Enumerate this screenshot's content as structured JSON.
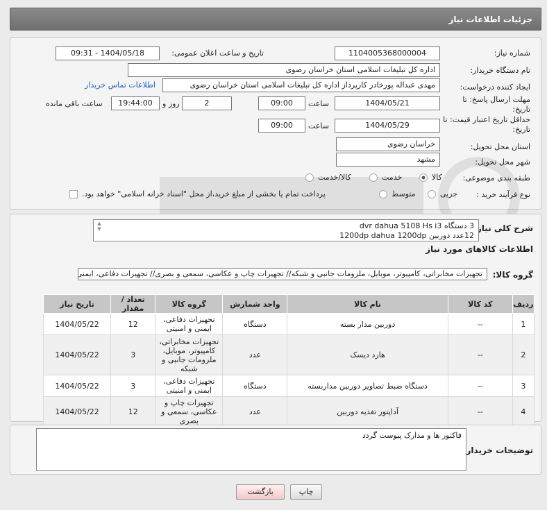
{
  "header": {
    "title": "جزئیات اطلاعات نیاز"
  },
  "form": {
    "need_number_label": "شماره نیاز:",
    "need_number": "1104005368000004",
    "announce_label": "تاریخ و ساعت اعلان عمومی:",
    "announce_value": "1404/05/18 - 09:31",
    "buyer_org_label": "نام دستگاه خریدار:",
    "buyer_org": "اداره کل تبلیغات اسلامی استان خراسان رضوی",
    "creator_label": "ایجاد کننده درخواست:",
    "creator": "مهدی عبداله پورخادر کارپرداز اداره کل تبلیغات اسلامی استان خراسان رضوی",
    "contact_link": "اطلاعات تماس خریدار",
    "deadline_label": "مهلت ارسال پاسخ: تا تاریخ:",
    "deadline_date": "1404/05/21",
    "time_label": "ساعت",
    "deadline_time": "09:00",
    "days_count": "2",
    "days_label": "روز و",
    "remaining_time": "19:44:00",
    "remaining_label": "ساعت باقی مانده",
    "price_validity_label": "حداقل تاریخ اعتبار قیمت: تا تاریخ:",
    "price_validity_date": "1404/05/29",
    "price_validity_time": "09:00",
    "province_label": "استان محل تحویل:",
    "province": "خراسان رضوی",
    "city_label": "شهر محل تحویل:",
    "city": "مشهد",
    "category_label": "طبقه بندی موضوعی:",
    "category_options": [
      "کالا",
      "خدمت",
      "کالا/خدمت"
    ],
    "process_label": "نوع فرآیند خرید :",
    "process_options": [
      "جزیی",
      "متوسط"
    ],
    "payment_note": "پرداخت تمام یا بخشی از مبلغ خرید،از محل \"اسناد خزانه اسلامی\" خواهد بود."
  },
  "description": {
    "label": "شرح کلی نیاز:",
    "line1": "3 دستگاه  dvr dahua 5108 Hs i3",
    "line2": "12عدد دوربین  1200dp dahua 1200dp"
  },
  "goods": {
    "section_title": "اطلاعات کالاهای مورد نیاز",
    "group_label": "گروه کالا:",
    "group_value": "تجهیزات مخابراتی، کامپیوتر، موبایل، ملزومات جانبی و شبکه// تجهیزات چاپ و عکاسی، سمعی و بصری// تجهیزات دفاعی، ایمنی و امنیتی"
  },
  "table": {
    "headers": [
      "ردیف",
      "کد کالا",
      "نام کالا",
      "واحد شمارش",
      "گروه کالا",
      "تعداد / مقدار",
      "تاریخ نیاز"
    ],
    "rows": [
      {
        "row": "1",
        "code": "--",
        "name": "دوربین مدار بسته",
        "unit": "دستگاه",
        "group": "تجهیزات دفاعی، ایمنی و امنیتی",
        "qty": "12",
        "date": "1404/05/22"
      },
      {
        "row": "2",
        "code": "--",
        "name": "هارد دیسک",
        "unit": "عدد",
        "group": "تجهیزات مخابراتی، کامپیوتر، موبایل، ملزومات جانبی و شبکه",
        "qty": "3",
        "date": "1404/05/22"
      },
      {
        "row": "3",
        "code": "--",
        "name": "دستگاه ضبط تصاویر دوربین مداربسته",
        "unit": "دستگاه",
        "group": "تجهیزات دفاعی، ایمنی و امنیتی",
        "qty": "3",
        "date": "1404/05/22"
      },
      {
        "row": "4",
        "code": "--",
        "name": "آداپتور تغذیه دوربین",
        "unit": "عدد",
        "group": "تجهیزات چاپ و عکاسی، سمعی و بصری",
        "qty": "12",
        "date": "1404/05/22"
      }
    ]
  },
  "buyer_notes": {
    "label": "توضیحات خریدار:",
    "text": "فاکتور ها و مدارک پیوست گردد"
  },
  "buttons": {
    "print": "چاپ",
    "back": "بازگشت"
  }
}
